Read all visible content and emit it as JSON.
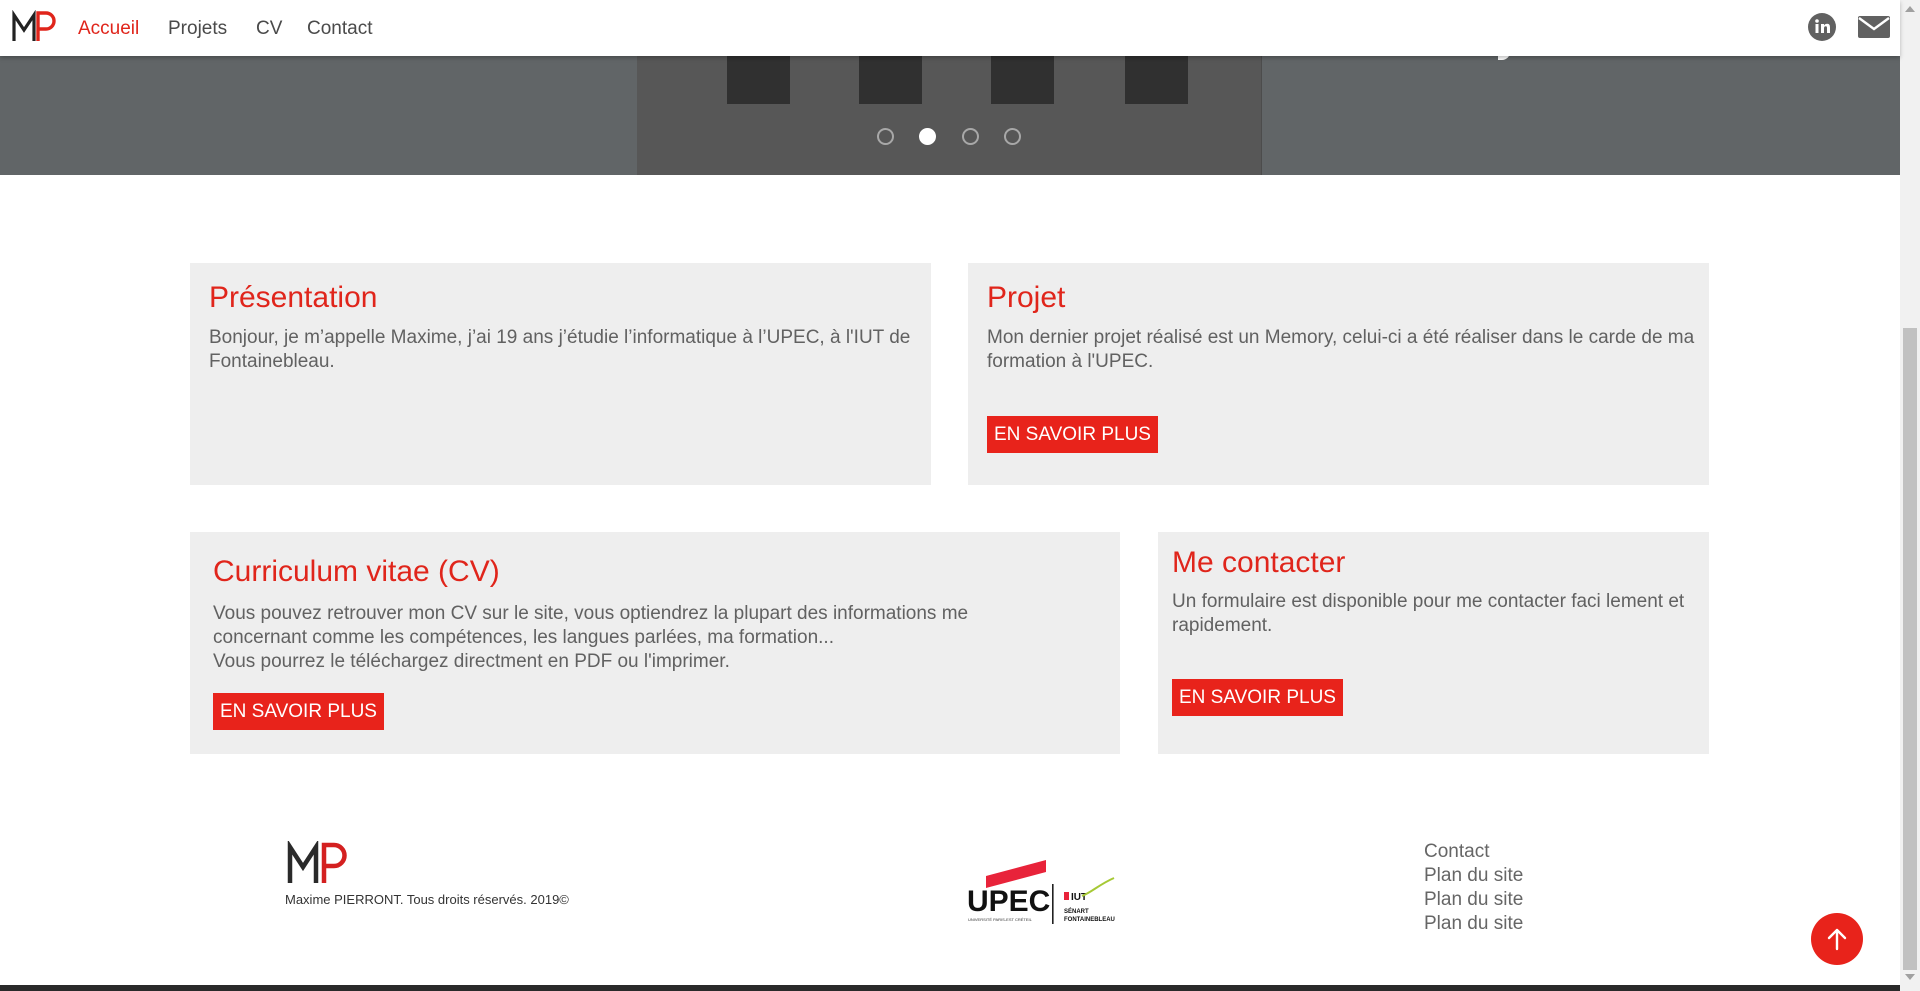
{
  "brand": {
    "logo_text": "MP",
    "accent_color": "#e0251b"
  },
  "nav": {
    "items": [
      {
        "label": "Accueil",
        "active": true
      },
      {
        "label": "Projets",
        "active": false
      },
      {
        "label": "CV",
        "active": false
      },
      {
        "label": "Contact",
        "active": false
      }
    ],
    "social": [
      "linkedin-icon",
      "mail-icon"
    ]
  },
  "carousel": {
    "slide_count": 4,
    "active_index": 1
  },
  "cards": {
    "presentation": {
      "title": "Présentation",
      "text": "Bonjour, je m’appelle Maxime, j’ai 19 ans j’étudie l’informatique à l’UPEC, à l'IUT de Fontainebleau."
    },
    "projet": {
      "title": "Projet",
      "text": "Mon dernier projet réalisé est un Memory, celui-ci a été réaliser dans le carde de ma formation à l'UPEC.",
      "button": "EN SAVOIR PLUS"
    },
    "cv": {
      "title": "Curriculum vitae (CV)",
      "text_1": "Vous pouvez retrouver mon CV sur le site, vous optiendrez la plupart des informations me concernant comme les compétences, les langues parlées, ma formation...",
      "text_2": "Vous pourrez le téléchargez directment en PDF ou l'imprimer.",
      "button": "EN SAVOIR PLUS"
    },
    "contact": {
      "title": "Me contacter",
      "text": "Un formulaire est disponible pour me contacter faci lement et rapidement.",
      "button": "EN SAVOIR PLUS"
    }
  },
  "footer": {
    "logo_text": "MP",
    "copyright": "Maxime PIERRONT. Tous droits réservés. 2019©",
    "partner_logo": {
      "name": "UPEC",
      "subtitle": "UNIVERSITÉ PARIS-EST CRÉTEIL",
      "iut_label": "IUT",
      "iut_line_1": "SÉNART",
      "iut_line_2": "FONTAINEBLEAU"
    },
    "links": [
      "Contact",
      "Plan du site",
      "Plan du site",
      "Plan du site"
    ]
  },
  "back_to_top": {
    "icon": "arrow-up-icon"
  }
}
